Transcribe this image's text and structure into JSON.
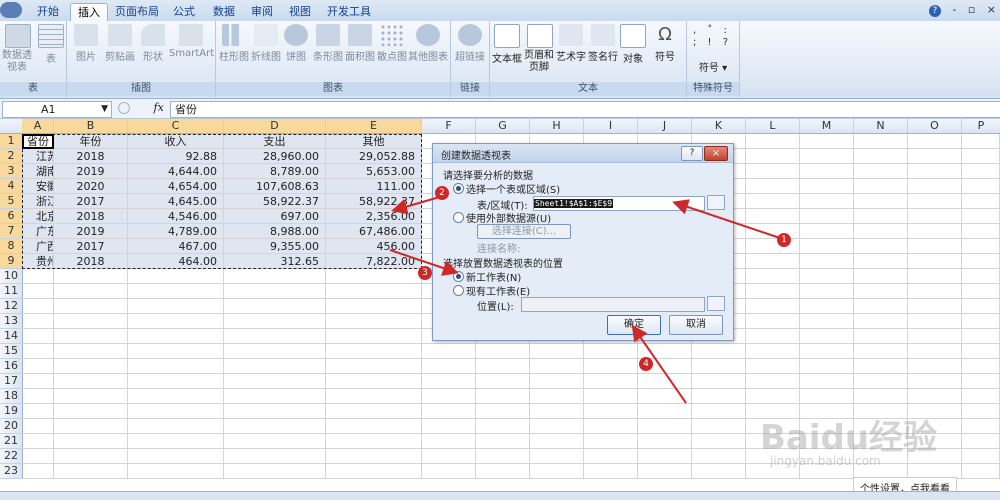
{
  "tabs": [
    "开始",
    "插入",
    "页面布局",
    "公式",
    "数据",
    "审阅",
    "视图",
    "开发工具"
  ],
  "window_controls": [
    "?",
    "-",
    "▫",
    "×"
  ],
  "ribbon": {
    "groups": [
      {
        "label": "表",
        "buttons": [
          "数据透视表",
          "表"
        ]
      },
      {
        "label": "插图",
        "buttons": [
          "图片",
          "剪贴画",
          "形状",
          "SmartArt"
        ]
      },
      {
        "label": "图表",
        "buttons": [
          "柱形图",
          "折线图",
          "饼图",
          "条形图",
          "面积图",
          "散点图",
          "其他图表"
        ]
      },
      {
        "label": "链接",
        "buttons": [
          "超链接"
        ]
      },
      {
        "label": "文本",
        "buttons": [
          "文本框",
          "页眉和页脚",
          "艺术字",
          "签名行",
          "对象",
          "符号"
        ]
      },
      {
        "label": "特殊符号",
        "buttons": [
          "符号"
        ]
      }
    ]
  },
  "formula_bar": {
    "name_box": "A1",
    "fx": "fx",
    "value": "省份"
  },
  "columns": [
    "A",
    "B",
    "C",
    "D",
    "E",
    "F",
    "G",
    "H",
    "I",
    "J",
    "K",
    "L",
    "M",
    "N",
    "O",
    "P"
  ],
  "rows": [
    "1",
    "2",
    "3",
    "4",
    "5",
    "6",
    "7",
    "8",
    "9",
    "10",
    "11",
    "12",
    "13",
    "14",
    "15",
    "16",
    "17",
    "18",
    "19",
    "20",
    "21",
    "22",
    "23"
  ],
  "table": {
    "header": [
      "省份",
      "年份",
      "收入",
      "支出",
      "其他"
    ],
    "data": [
      [
        "江苏",
        "2018",
        "92.88",
        "28,960.00",
        "29,052.88"
      ],
      [
        "湖南",
        "2019",
        "4,644.00",
        "8,789.00",
        "5,653.00"
      ],
      [
        "安徽",
        "2020",
        "4,654.00",
        "107,608.63",
        "111.00"
      ],
      [
        "浙江",
        "2017",
        "4,645.00",
        "58,922.37",
        "58,922.37"
      ],
      [
        "北京",
        "2018",
        "4,546.00",
        "697.00",
        "2,356.00"
      ],
      [
        "广东",
        "2019",
        "4,789.00",
        "8,988.00",
        "67,486.00"
      ],
      [
        "广西",
        "2017",
        "467.00",
        "9,355.00",
        "456.00"
      ],
      [
        "贵州",
        "2018",
        "464.00",
        "312.65",
        "7,822.00"
      ]
    ]
  },
  "dialog": {
    "title": "创建数据透视表",
    "section1": "请选择要分析的数据",
    "opt_range": "选择一个表或区域(S)",
    "range_label": "表/区域(T):",
    "range_value": "Sheet1!$A$1:$E$9",
    "opt_external": "使用外部数据源(U)",
    "choose_conn": "选择连接(C)...",
    "conn_name": "连接名称:",
    "section2": "选择放置数据透视表的位置",
    "opt_new": "新工作表(N)",
    "opt_existing": "现有工作表(E)",
    "location_label": "位置(L):",
    "ok": "确定",
    "cancel": "取消"
  },
  "annotations": [
    "1",
    "2",
    "3",
    "4"
  ],
  "watermark": "Baidu经验",
  "watermark_url": "jingyan.baidu.com",
  "tooltip": "个性设置，点我看看",
  "colors": {
    "accent": "#15428b",
    "arrow": "#d0282a"
  }
}
